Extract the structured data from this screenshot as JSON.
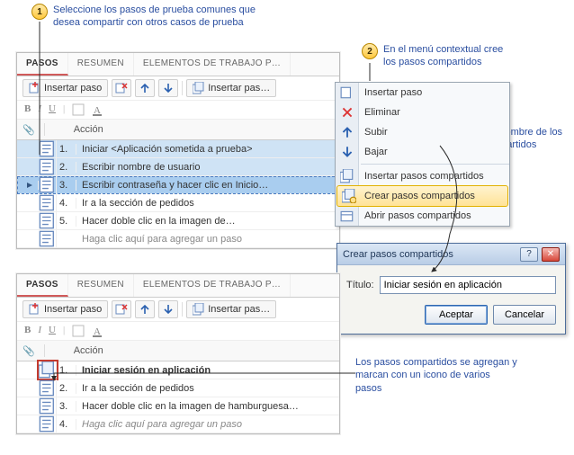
{
  "callouts": {
    "c1": "Seleccione los pasos de prueba comunes que desea compartir con otros casos de prueba",
    "c2": "En el menú contextual cree los pasos compartidos",
    "c3": "Escriba el nombre de los pasos compartidos",
    "c4": "Los pasos compartidos se agregan y marcan con un icono de varios pasos"
  },
  "tabs": {
    "steps": "PASOS",
    "summary": "RESUMEN",
    "work_items": "ELEMENTOS DE TRABAJO P…"
  },
  "toolbar": {
    "insert_step": "Insertar paso",
    "insert_shared": "Insertar pas…"
  },
  "format": {
    "b": "B",
    "i": "I",
    "u": "U"
  },
  "header": {
    "attach": "📎",
    "action": "Acción"
  },
  "panel1_rows": [
    {
      "n": "1.",
      "t": "Iniciar <Aplicación sometida a prueba>",
      "sel": true
    },
    {
      "n": "2.",
      "t": "Escribir nombre de usuario",
      "sel": true
    },
    {
      "n": "3.",
      "t": "Escribir contraseña y hacer clic en Inicio…",
      "sel": true,
      "active": true
    },
    {
      "n": "4.",
      "t": "Ir a la sección de pedidos"
    },
    {
      "n": "5.",
      "t": "Hacer doble clic en la imagen de…"
    },
    {
      "n": "",
      "t": "Haga clic aquí para agregar un paso",
      "ph": true
    }
  ],
  "panel2_rows": [
    {
      "n": "1.",
      "t": "Iniciar sesión en aplicación",
      "shared": true,
      "bold": true
    },
    {
      "n": "2.",
      "t": "Ir a la sección de pedidos"
    },
    {
      "n": "3.",
      "t": "Hacer doble clic en la imagen de hamburguesa…"
    },
    {
      "n": "4.",
      "t": "Haga clic aquí para agregar un paso",
      "ph": true,
      "it": true
    }
  ],
  "ctx": {
    "insert_step": "Insertar paso",
    "delete": "Eliminar",
    "up": "Subir",
    "down": "Bajar",
    "insert_shared": "Insertar pasos compartidos",
    "create_shared": "Crear pasos compartidos",
    "open_shared": "Abrir pasos compartidos"
  },
  "dialog": {
    "title": "Crear pasos compartidos",
    "field_label": "Título:",
    "field_value": "Iniciar sesión en aplicación",
    "ok": "Aceptar",
    "cancel": "Cancelar",
    "help": "?",
    "close": "✕"
  }
}
